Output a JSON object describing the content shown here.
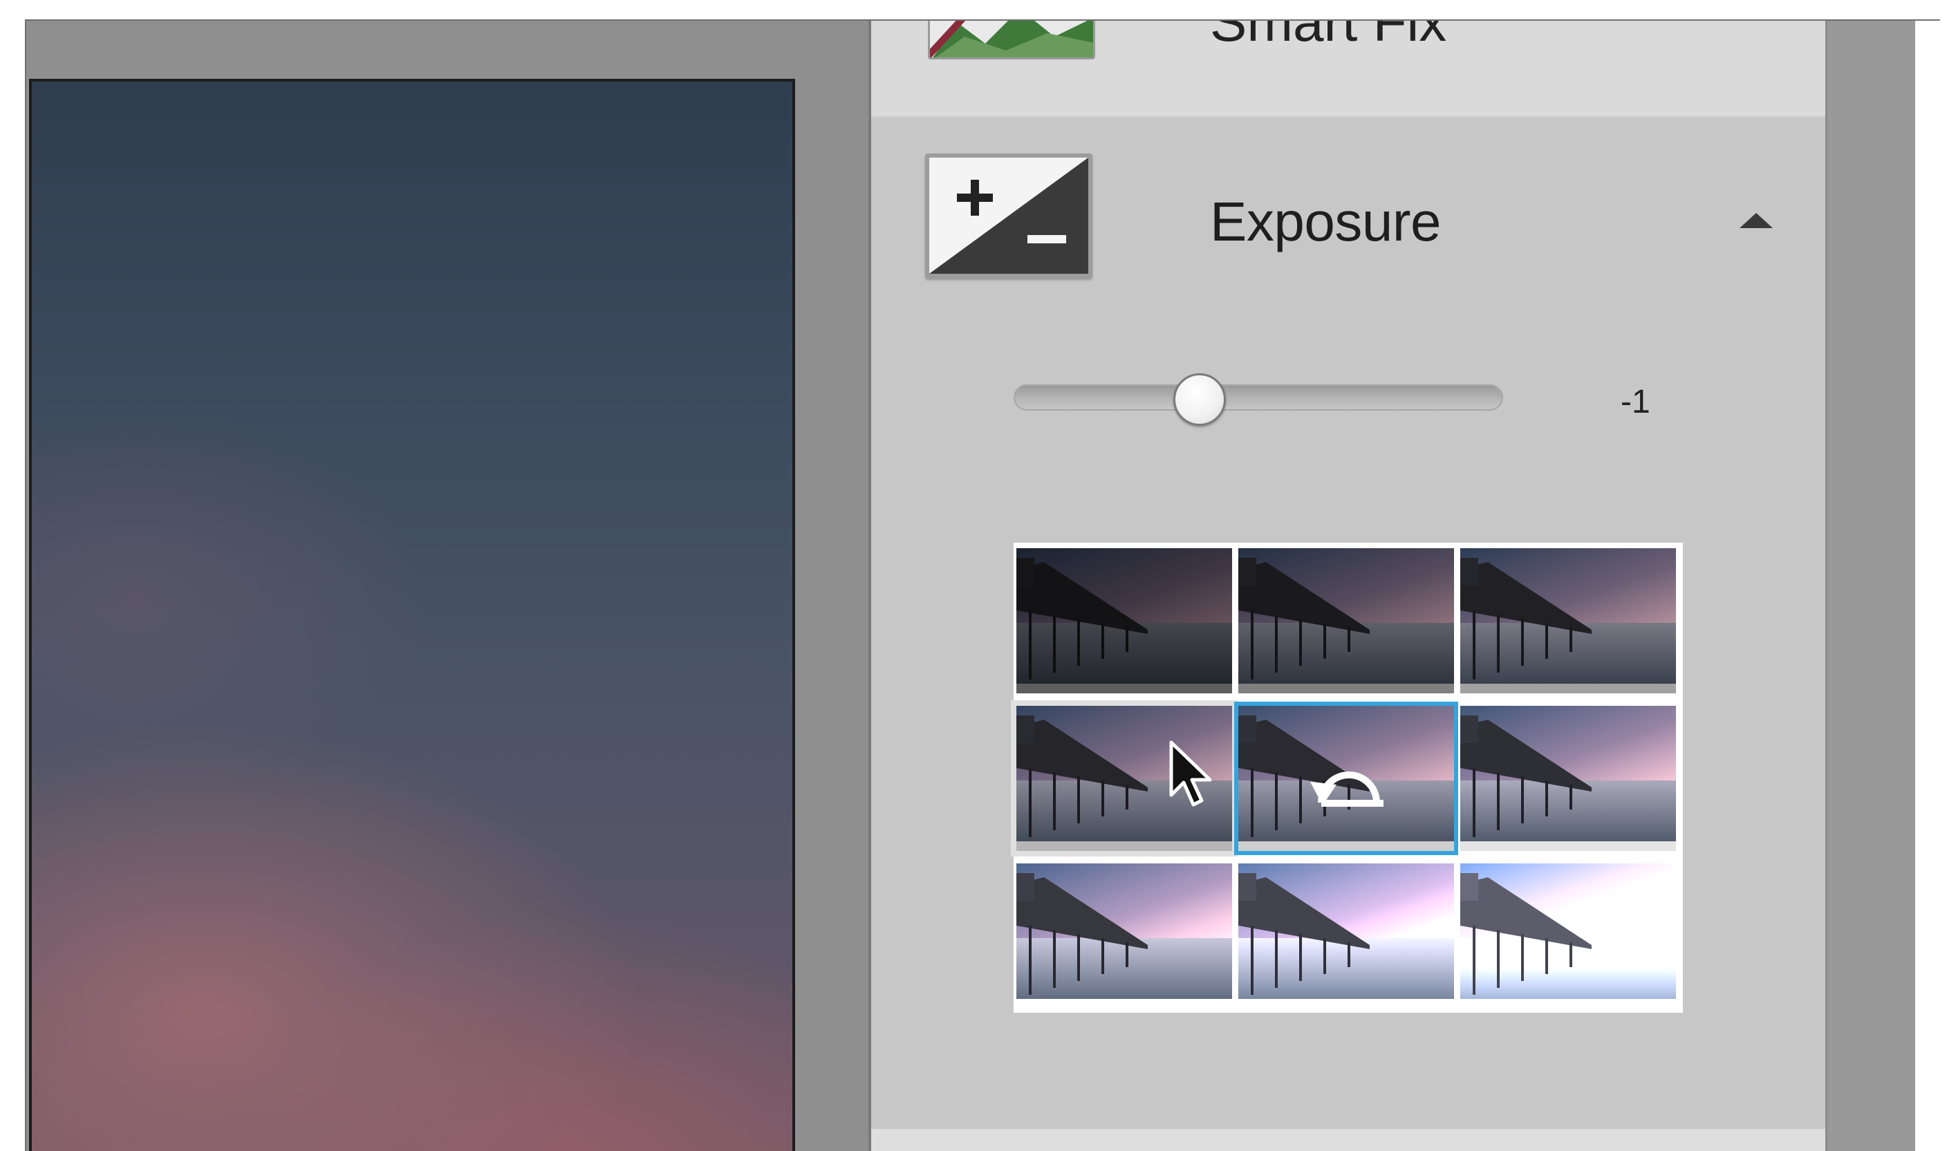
{
  "smartfix": {
    "label": "Smart Fix"
  },
  "exposure": {
    "label": "Exposure",
    "icon": "plus-minus-exposure-icon",
    "collapse_icon": "triangle-up-icon",
    "slider_value": "-1",
    "slider_fraction": 0.38
  },
  "variants": [
    {
      "name": "variant-1",
      "brightness": 0.45
    },
    {
      "name": "variant-2",
      "brightness": 0.62
    },
    {
      "name": "variant-3",
      "brightness": 0.78
    },
    {
      "name": "variant-4",
      "brightness": 0.88,
      "state": "hover"
    },
    {
      "name": "variant-5",
      "brightness": 1.0,
      "state": "current"
    },
    {
      "name": "variant-6",
      "brightness": 1.1
    },
    {
      "name": "variant-7",
      "brightness": 1.3
    },
    {
      "name": "variant-8",
      "brightness": 1.6
    },
    {
      "name": "variant-9",
      "brightness": 2.2
    }
  ],
  "colors": {
    "selection": "#35a4dc",
    "panel": "#c7c7c7"
  },
  "cursor_icon": "arrow-cursor-icon",
  "reset_icon": "reset-arrow-icon"
}
